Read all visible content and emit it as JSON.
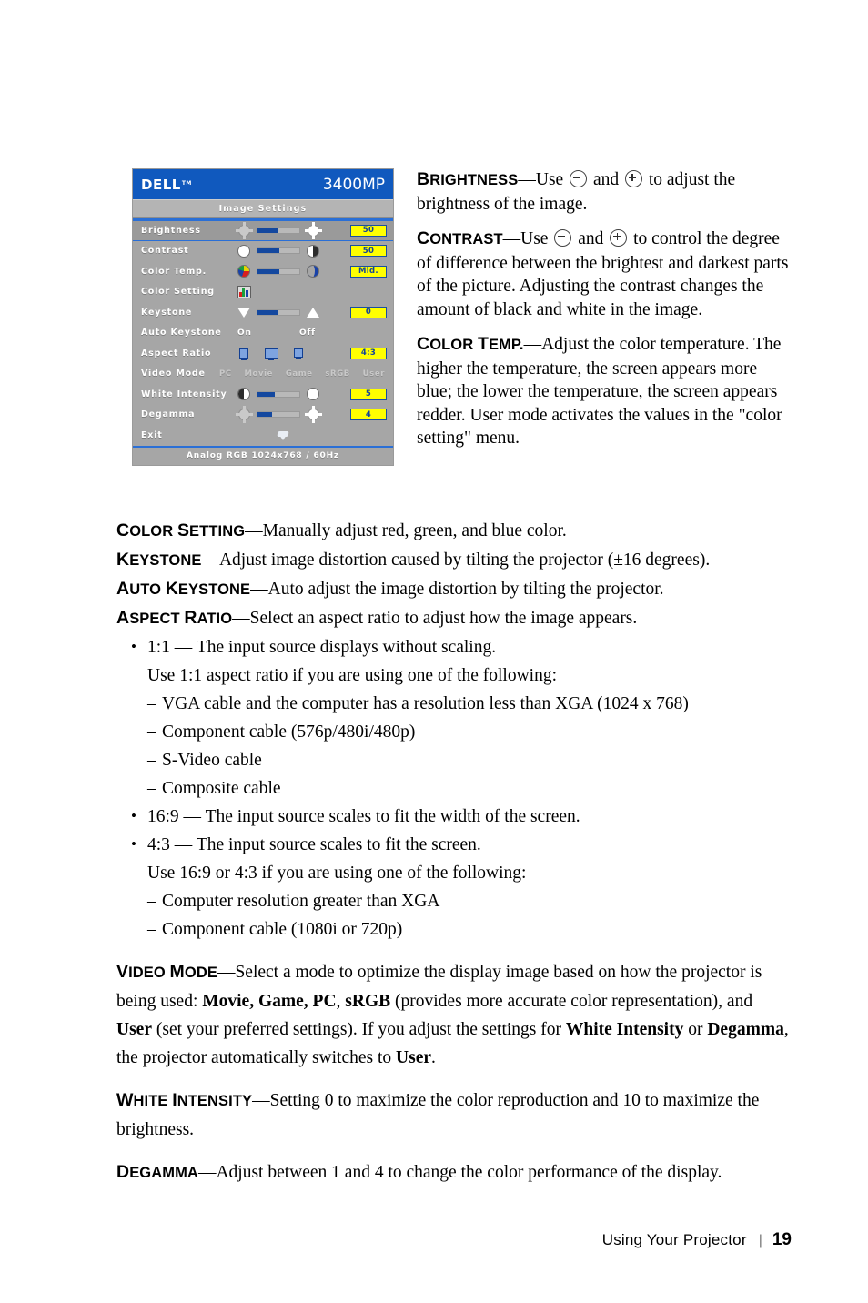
{
  "osd": {
    "brand": "DELL",
    "brand_tm": "TM",
    "model": "3400MP",
    "menu_title": "Image Settings",
    "status_bar": "Analog RGB 1024x768 / 60Hz",
    "rows": [
      {
        "label": "Brightness",
        "value": "50",
        "slider_pct": 50,
        "selected": true
      },
      {
        "label": "Contrast",
        "value": "50",
        "slider_pct": 50,
        "selected": false
      },
      {
        "label": "Color Temp.",
        "value": "Mid.",
        "slider_pct": 52,
        "selected": false
      },
      {
        "label": "Color Setting",
        "value": "",
        "slider_pct": 0,
        "selected": false
      },
      {
        "label": "Keystone",
        "value": "0",
        "slider_pct": 50,
        "selected": false
      },
      {
        "label": "Auto Keystone",
        "value": "",
        "slider_pct": 0,
        "selected": false
      },
      {
        "label": "Aspect Ratio",
        "value": "4:3",
        "slider_pct": 0,
        "selected": false
      },
      {
        "label": "Video Mode",
        "value": "",
        "slider_pct": 0,
        "selected": false
      },
      {
        "label": "White Intensity",
        "value": "5",
        "slider_pct": 42,
        "selected": false
      },
      {
        "label": "Degamma",
        "value": "4",
        "slider_pct": 35,
        "selected": false
      },
      {
        "label": "Exit",
        "value": "",
        "slider_pct": 0,
        "selected": false
      }
    ],
    "auto_keystone": {
      "on": "On",
      "off": "Off"
    },
    "video_modes": [
      "PC",
      "Movie",
      "Game",
      "sRGB",
      "User"
    ],
    "colors": {
      "title_blue": "#1059be",
      "panel_gray": "#a6a6a6",
      "value_yellow": "#ffff00",
      "slider_blue": "#14489f",
      "highlight_border": "#2a6fd6"
    }
  },
  "side": {
    "brightness": {
      "term_first": "B",
      "term_rest": "RIGHTNESS",
      "text_a": "—Use",
      "text_b": "and",
      "text_c": "to adjust the brightness of the image."
    },
    "contrast": {
      "term_first": "C",
      "term_rest": "ONTRAST",
      "text_a": "—Use",
      "text_b": "and",
      "text_c": "to control the degree of difference between the brightest and darkest parts of the picture. Adjusting the contrast changes the amount of black and white in the image."
    },
    "color_temp": {
      "term_first": "C",
      "term_rest": "OLOR ",
      "term_first2": "T",
      "term_rest2": "EMP.",
      "text": "—Adjust the color temperature. The higher the temperature, the screen appears more blue; the lower the temperature, the screen appears redder. User mode activates the values in the \"color setting\" menu."
    }
  },
  "flow": {
    "color_setting": {
      "t1": "C",
      "t2": "OLOR ",
      "t3": "S",
      "t4": "ETTING",
      "text": "—Manually adjust red, green, and blue color."
    },
    "keystone": {
      "t1": "K",
      "t2": "EYSTONE",
      "text": "—Adjust image distortion caused by tilting the projector (±16 degrees)."
    },
    "auto_keystone": {
      "t1": "A",
      "t2": "UTO ",
      "t3": "K",
      "t4": "EYSTONE",
      "text": "—Auto adjust the image distortion by tilting the projector."
    },
    "aspect_ratio": {
      "t1": "A",
      "t2": "SPECT ",
      "t3": "R",
      "t4": "ATIO",
      "text": "—Select an aspect ratio to adjust how the image appears."
    },
    "bullets": [
      {
        "kind": "bullet",
        "text": "1:1 — The input source displays without scaling."
      },
      {
        "kind": "sub",
        "text": "Use 1:1 aspect ratio if you are using one of the following:"
      },
      {
        "kind": "dash",
        "text": "VGA cable and the computer has a resolution less than XGA (1024 x 768)"
      },
      {
        "kind": "dash",
        "text": "Component cable (576p/480i/480p)"
      },
      {
        "kind": "dash",
        "text": "S-Video cable"
      },
      {
        "kind": "dash",
        "text": "Composite cable"
      },
      {
        "kind": "bullet",
        "text": "16:9 — The input source scales to fit the width of the screen."
      },
      {
        "kind": "bullet",
        "text": "4:3 — The input source scales to fit the screen."
      },
      {
        "kind": "sub",
        "text": "Use 16:9 or 4:3 if you are using one of the following:"
      },
      {
        "kind": "dash",
        "text": "Computer resolution greater than XGA"
      },
      {
        "kind": "dash",
        "text": "Component cable (1080i or 720p)"
      }
    ],
    "video_mode": {
      "t1": "V",
      "t2": "IDEO ",
      "t3": "M",
      "t4": "ODE",
      "p1": "—Select a mode to optimize the display image based on how the projector is being used: ",
      "b1": "Movie, Game, PC",
      "p2": ", ",
      "b2": "sRGB",
      "p3": " (provides more accurate color representation), and ",
      "b3": "User",
      "p4": " (set your preferred settings). If you adjust the settings for ",
      "b4": "White Intensity",
      "p5": " or ",
      "b5": "Degamma",
      "p6": ", the projector automatically switches to ",
      "b6": "User",
      "p7": "."
    },
    "white_intensity": {
      "t1": "W",
      "t2": "HITE ",
      "t3": "I",
      "t4": "NTENSITY",
      "text": "—Setting 0 to maximize the color reproduction and 10 to maximize the brightness."
    },
    "degamma": {
      "t1": "D",
      "t2": "EGAMMA",
      "text": "—Adjust between 1 and 4 to change the color performance of the display."
    }
  },
  "footer": {
    "title": "Using Your Projector",
    "separator": "|",
    "page_number": "19"
  }
}
